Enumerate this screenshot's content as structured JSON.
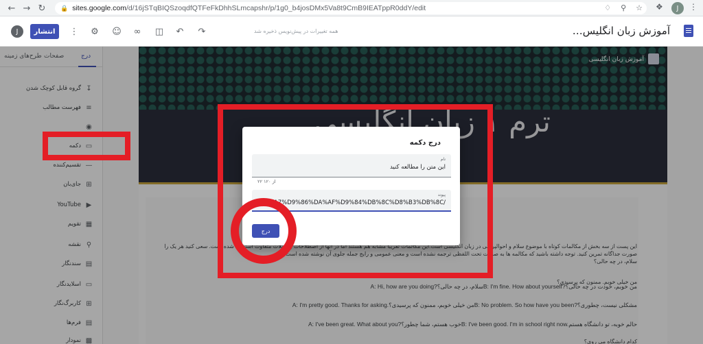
{
  "browser": {
    "url_host": "sites.google.com",
    "url_path": "/d/16jSTqBIQSzoqdfQTFeFkDhhSLmcapshr/p/1g0_b4josDMx5Va8t9CmB9IEATppR0ddY/edit",
    "profile_initial": "J"
  },
  "toolbar": {
    "avatar_initial": "J",
    "publish_label": "انتشار",
    "draft_status": "همه تغییرات در پیش‌نویس ذخیره شد",
    "site_title": "آموزش زبان انگلیس…"
  },
  "sidebar": {
    "tabs": [
      {
        "label": "درج",
        "active": true
      },
      {
        "label": "صفحات",
        "active": false
      },
      {
        "label": "طرح‌های زمینه",
        "active": false
      }
    ],
    "items": [
      {
        "label": "گروه قابل کوچک شدن",
        "icon": "collapsible-icon"
      },
      {
        "label": "فهرست مطالب",
        "icon": "toc-icon"
      },
      {
        "label": "",
        "icon": "gallery-icon"
      },
      {
        "label": "دکمه",
        "icon": "button-icon"
      },
      {
        "label": "تقسیم‌کننده",
        "icon": "divider-icon"
      },
      {
        "label": "جای‌بان",
        "icon": "placeholder-icon"
      },
      {
        "label": "YouTube",
        "icon": "youtube-icon"
      },
      {
        "label": "تقویم",
        "icon": "calendar-icon"
      },
      {
        "label": "نقشه",
        "icon": "map-icon"
      },
      {
        "label": "سندنگار",
        "icon": "docs-icon"
      },
      {
        "label": "اسلایدنگار",
        "icon": "slides-icon"
      },
      {
        "label": "کاربرگ‌نگار",
        "icon": "sheets-icon"
      },
      {
        "label": "فرم‌ها",
        "icon": "forms-icon"
      },
      {
        "label": "نمودار",
        "icon": "chart-icon"
      }
    ]
  },
  "hero": {
    "site_name": "آموزش زبان انگلیسی",
    "title": "ترم ۱ زبان انگلیسی"
  },
  "content": {
    "intro_1": "این پست از سه بخش از مکالمات کوتاه با موضوع سلام و احوالپرسی در زبان انگلیسی است.این مکالمات تقریبا مشابه هم هستند اما در آنها از اصطلاحات و جملات متفاوت استفاده شده است. سعی کنید هر یک را",
    "intro_2": "صورت جداگانه تمرین کنید. توجه داشته باشید که مکالمه ها به صورت تحت اللفظی ترجمه نشده است و معنی عمومی و رایج جمله جلوی آن نوشته شده است.",
    "intro_3": "سلام، در چه حالی؟",
    "line_1": "من خیلی خوبم. ممنون که پرسیدی؟",
    "line_2": "A: Hi, how are you doing?سلام، در چه حالی؟B: I'm fine. How about yourself?من خوبم، خودت در چه حالی؟",
    "line_3": "A: I'm pretty good. Thanks for asking.من خیلی خوبم، ممنون که پرسیدی؟B: No problem. So how have you been?مشکلی نیست، چطوری؟",
    "line_4": "A: I've been great. What about you?خوب هستم، شما چطور؟B: I've been good. I'm in school right now.حالم خوبه، تو دانشگاه هستم",
    "line_5": "کدام دانشگاه می روی؟"
  },
  "dialog": {
    "title": "درج دکمه",
    "name_label": "نام",
    "name_value": "این متن را مطالعه کنید",
    "counter": "۲۲ از ۱۲۰",
    "link_label": "پیوند",
    "link_value": "A7%D9%86%DA%AF%D9%84%DB%8C%D8%B3%DB%8C/",
    "insert_label": "درج"
  },
  "colors": {
    "accent": "#3f51b5",
    "annotation_red": "#e41e26",
    "hero_bg": "#1f2a30",
    "hero_band": "#c9a63e"
  }
}
